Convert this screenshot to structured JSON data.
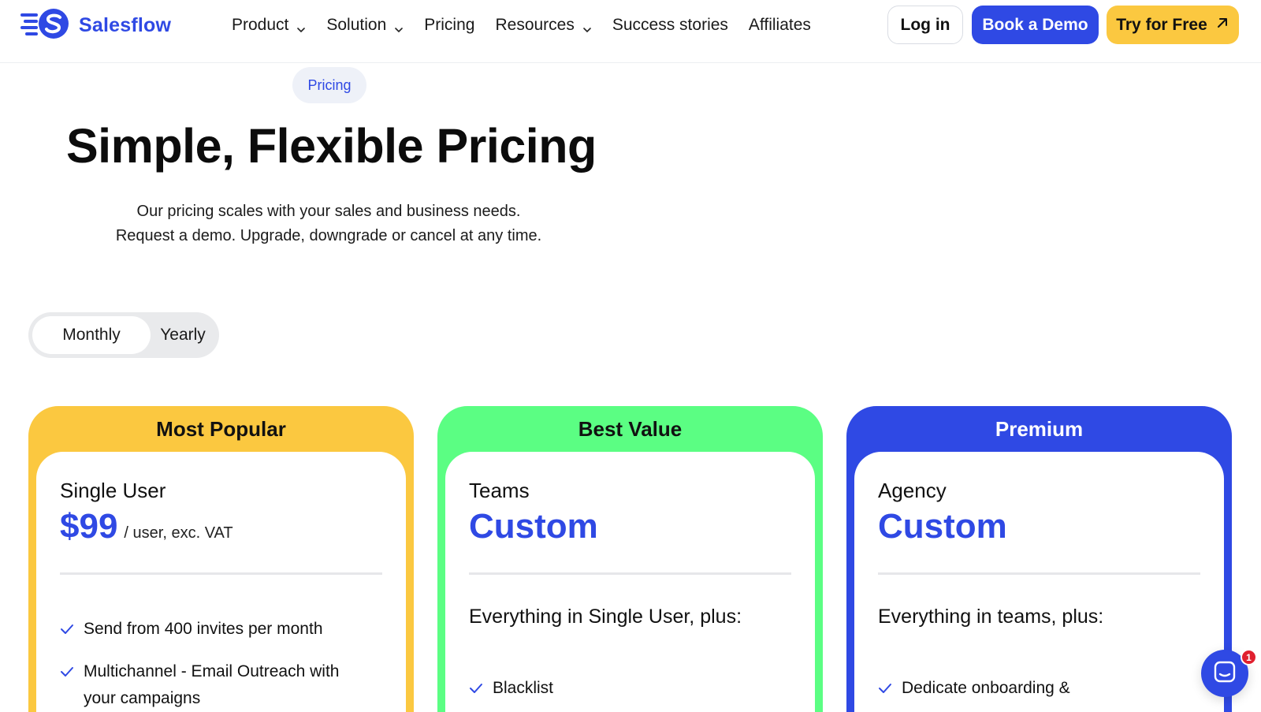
{
  "brand": {
    "name": "Salesflow",
    "color": "#2f49e4"
  },
  "nav": {
    "items": [
      {
        "label": "Product",
        "dropdown": true
      },
      {
        "label": "Solution",
        "dropdown": true
      },
      {
        "label": "Pricing",
        "dropdown": false
      },
      {
        "label": "Resources",
        "dropdown": true
      },
      {
        "label": "Success stories",
        "dropdown": false
      },
      {
        "label": "Affiliates",
        "dropdown": false
      }
    ],
    "login_label": "Log in",
    "demo_label": "Book a Demo",
    "free_label": "Try for Free"
  },
  "hero": {
    "pill": "Pricing",
    "title": "Simple, Flexible Pricing",
    "subtitle_line1": "Our pricing scales with your sales and business needs.",
    "subtitle_line2": "Request a demo. Upgrade, downgrade or cancel at any time."
  },
  "billing_toggle": {
    "options": [
      "Monthly",
      "Yearly"
    ],
    "selected": "Monthly"
  },
  "plans": [
    {
      "badge": "Most Popular",
      "name": "Single User",
      "price": "$99",
      "price_unit": "/ user, exc. VAT",
      "features": [
        "Send from 400 invites per month",
        "Multichannel - Email Outreach with your campaigns"
      ]
    },
    {
      "badge": "Best Value",
      "name": "Teams",
      "price": "Custom",
      "includes": "Everything in Single User, plus:",
      "features": [
        "Blacklist"
      ]
    },
    {
      "badge": "Premium",
      "name": "Agency",
      "price": "Custom",
      "includes": "Everything in teams, plus:",
      "features": [
        "Dedicate onboarding &"
      ]
    }
  ],
  "chat": {
    "unread_count": "1"
  },
  "colors": {
    "yellow": "#fbc840",
    "green": "#5bfe83",
    "blue": "#2f49e4",
    "badge_red": "#e0202f"
  }
}
